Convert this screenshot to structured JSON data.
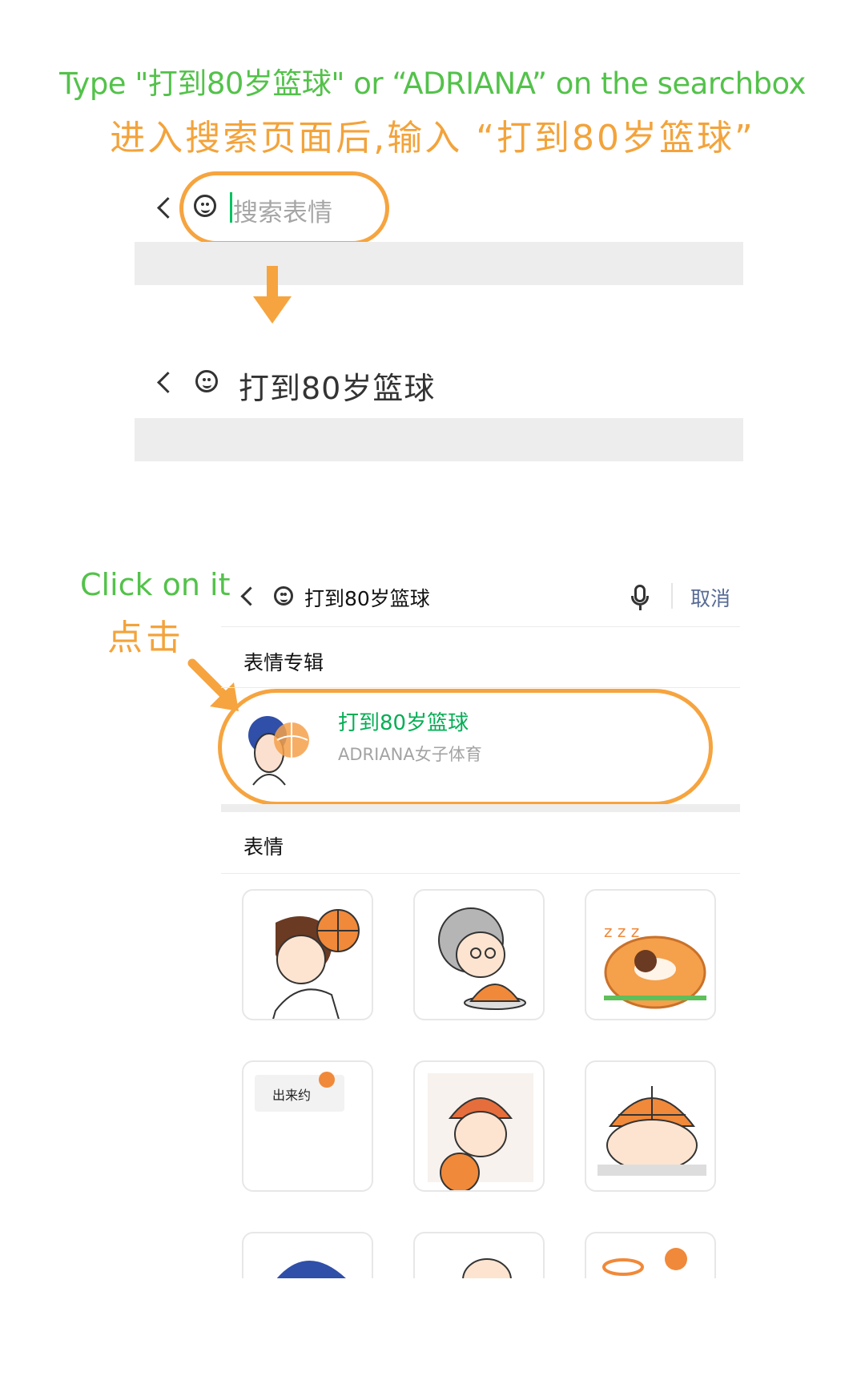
{
  "instructions": {
    "english": "Type \"打到80岁篮球\" or “ADRIANA” on the searchbox",
    "chinese": "进入搜索页面后,输入 “打到80岁篮球”",
    "click_en": "Click on it",
    "click_zh": "点击"
  },
  "step1": {
    "placeholder": "搜索表情"
  },
  "step2": {
    "query": "打到80岁篮球"
  },
  "step3": {
    "query": "打到80岁篮球",
    "cancel_label": "取消",
    "section_albums": "表情专辑",
    "album": {
      "title": "打到80岁篮球",
      "subtitle": "ADRIANA女子体育"
    },
    "section_stickers": "表情",
    "sticker_text": "出来约",
    "stickers": [
      "girl-basketball-sticker",
      "grandma-cake-sticker",
      "sleeping-donut-sticker",
      "chat-bubble-sticker",
      "hat-girl-sticker",
      "peeking-ball-sticker",
      "blue-hair-sticker",
      "baby-sticker",
      "hoop-sticker"
    ]
  },
  "colors": {
    "green": "#53c24a",
    "orange": "#f3a33b",
    "wechat_green": "#06ae56",
    "link_blue": "#576b95"
  }
}
